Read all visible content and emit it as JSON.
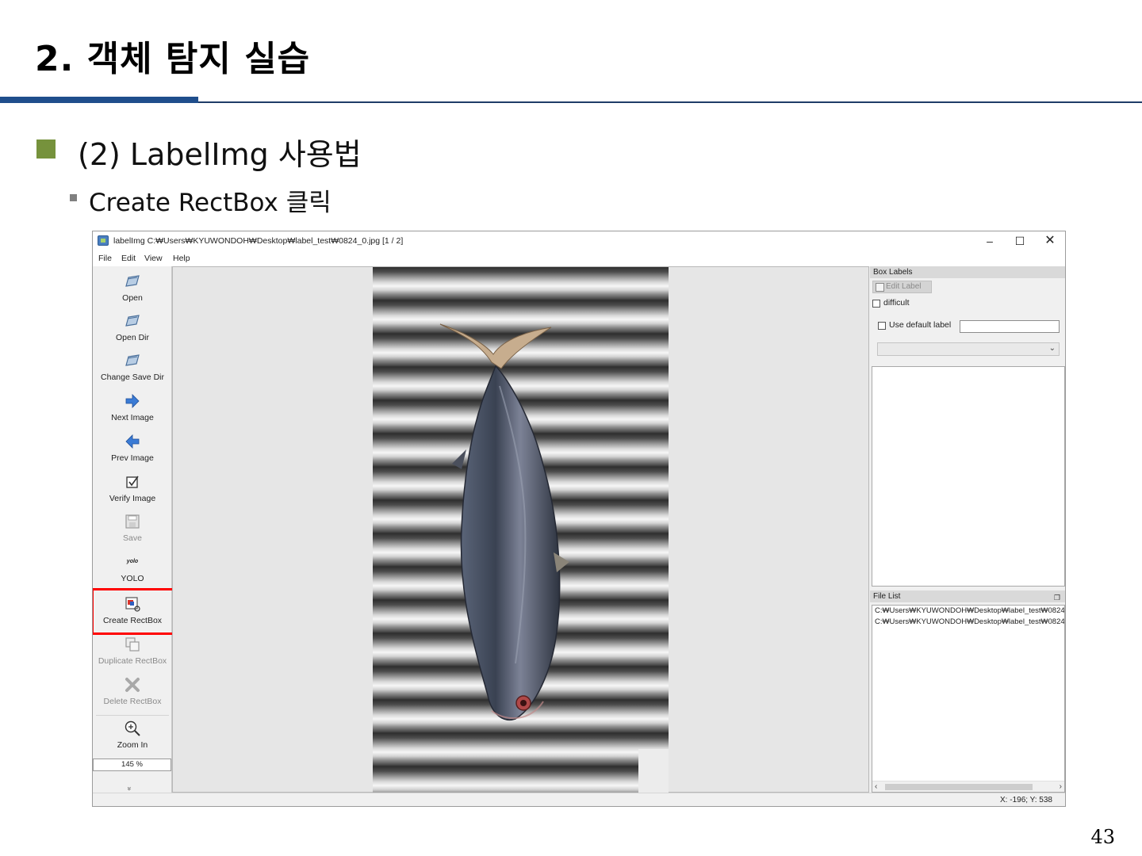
{
  "slide": {
    "title": "2. 객체 탐지 실습",
    "heading": "(2) LabelImg 사용법",
    "subheading": "Create RectBox 클릭",
    "page_number": "43",
    "colors": {
      "accent_bar": "#1f4e8c",
      "bullet": "#76923c",
      "highlight": "#ff0000"
    }
  },
  "window": {
    "title": "labelImg C:₩Users₩KYUWONDOH₩Desktop₩label_test₩0824_0.jpg [1 / 2]",
    "controls": {
      "minimize": "–",
      "maximize": "☐",
      "close": "✕"
    },
    "menu": [
      "File",
      "Edit",
      "View",
      "Help"
    ]
  },
  "toolbar": {
    "tools": [
      {
        "label": "Open",
        "icon": "folder-icon",
        "enabled": true
      },
      {
        "label": "Open Dir",
        "icon": "folder-icon",
        "enabled": true
      },
      {
        "label": "Change Save Dir",
        "icon": "folder-icon",
        "enabled": true
      },
      {
        "label": "Next Image",
        "icon": "arrow-right-icon",
        "enabled": true
      },
      {
        "label": "Prev Image",
        "icon": "arrow-left-icon",
        "enabled": true
      },
      {
        "label": "Verify Image",
        "icon": "checkbox-icon",
        "enabled": true
      },
      {
        "label": "Save",
        "icon": "save-icon",
        "enabled": false
      },
      {
        "label": "YOLO",
        "icon": "yolo-icon",
        "icon_text": "yolo",
        "enabled": true
      },
      {
        "label": "Create RectBox",
        "icon": "create-rectbox-icon",
        "enabled": true,
        "highlighted": true
      },
      {
        "label": "Duplicate RectBox",
        "icon": "duplicate-icon",
        "enabled": false
      },
      {
        "label": "Delete RectBox",
        "icon": "delete-icon",
        "enabled": false
      },
      {
        "label": "Zoom In",
        "icon": "zoom-in-icon",
        "enabled": true
      }
    ],
    "zoom_value": "145 %",
    "more": "»"
  },
  "dock": {
    "box_labels_title": "Box Labels",
    "edit_label": "Edit Label",
    "difficult": "difficult",
    "use_default_label": "Use default label",
    "default_label_value": "",
    "file_list_title": "File List",
    "files": [
      "C:₩Users₩KYUWONDOH₩Desktop₩label_test₩0824",
      "C:₩Users₩KYUWONDOH₩Desktop₩label_test₩0824"
    ]
  },
  "status": {
    "coords": "X: -196; Y: 538"
  }
}
